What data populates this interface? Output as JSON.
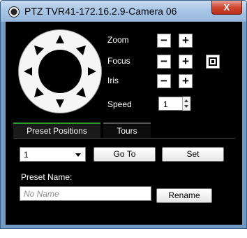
{
  "window": {
    "title": "PTZ  TVR41-172.16.2.9-Camera 06",
    "close_glyph": "X",
    "app_icon": "camera-lens-icon"
  },
  "controls": {
    "zoom_label": "Zoom",
    "focus_label": "Focus",
    "iris_label": "Iris",
    "speed_label": "Speed",
    "minus_glyph": "−",
    "plus_glyph": "+",
    "speed_value": "1"
  },
  "tabs": [
    {
      "label": "Preset Positions",
      "active": true
    },
    {
      "label": "Tours",
      "active": false
    }
  ],
  "preset": {
    "selected": "1",
    "goto_label": "Go To",
    "set_label": "Set",
    "name_label": "Preset Name:",
    "name_placeholder": "No Name",
    "rename_label": "Rename"
  },
  "colors": {
    "active_tab_accent": "#2e9a2e",
    "titlebar": "#a9c6e6",
    "close": "#d0462f"
  }
}
